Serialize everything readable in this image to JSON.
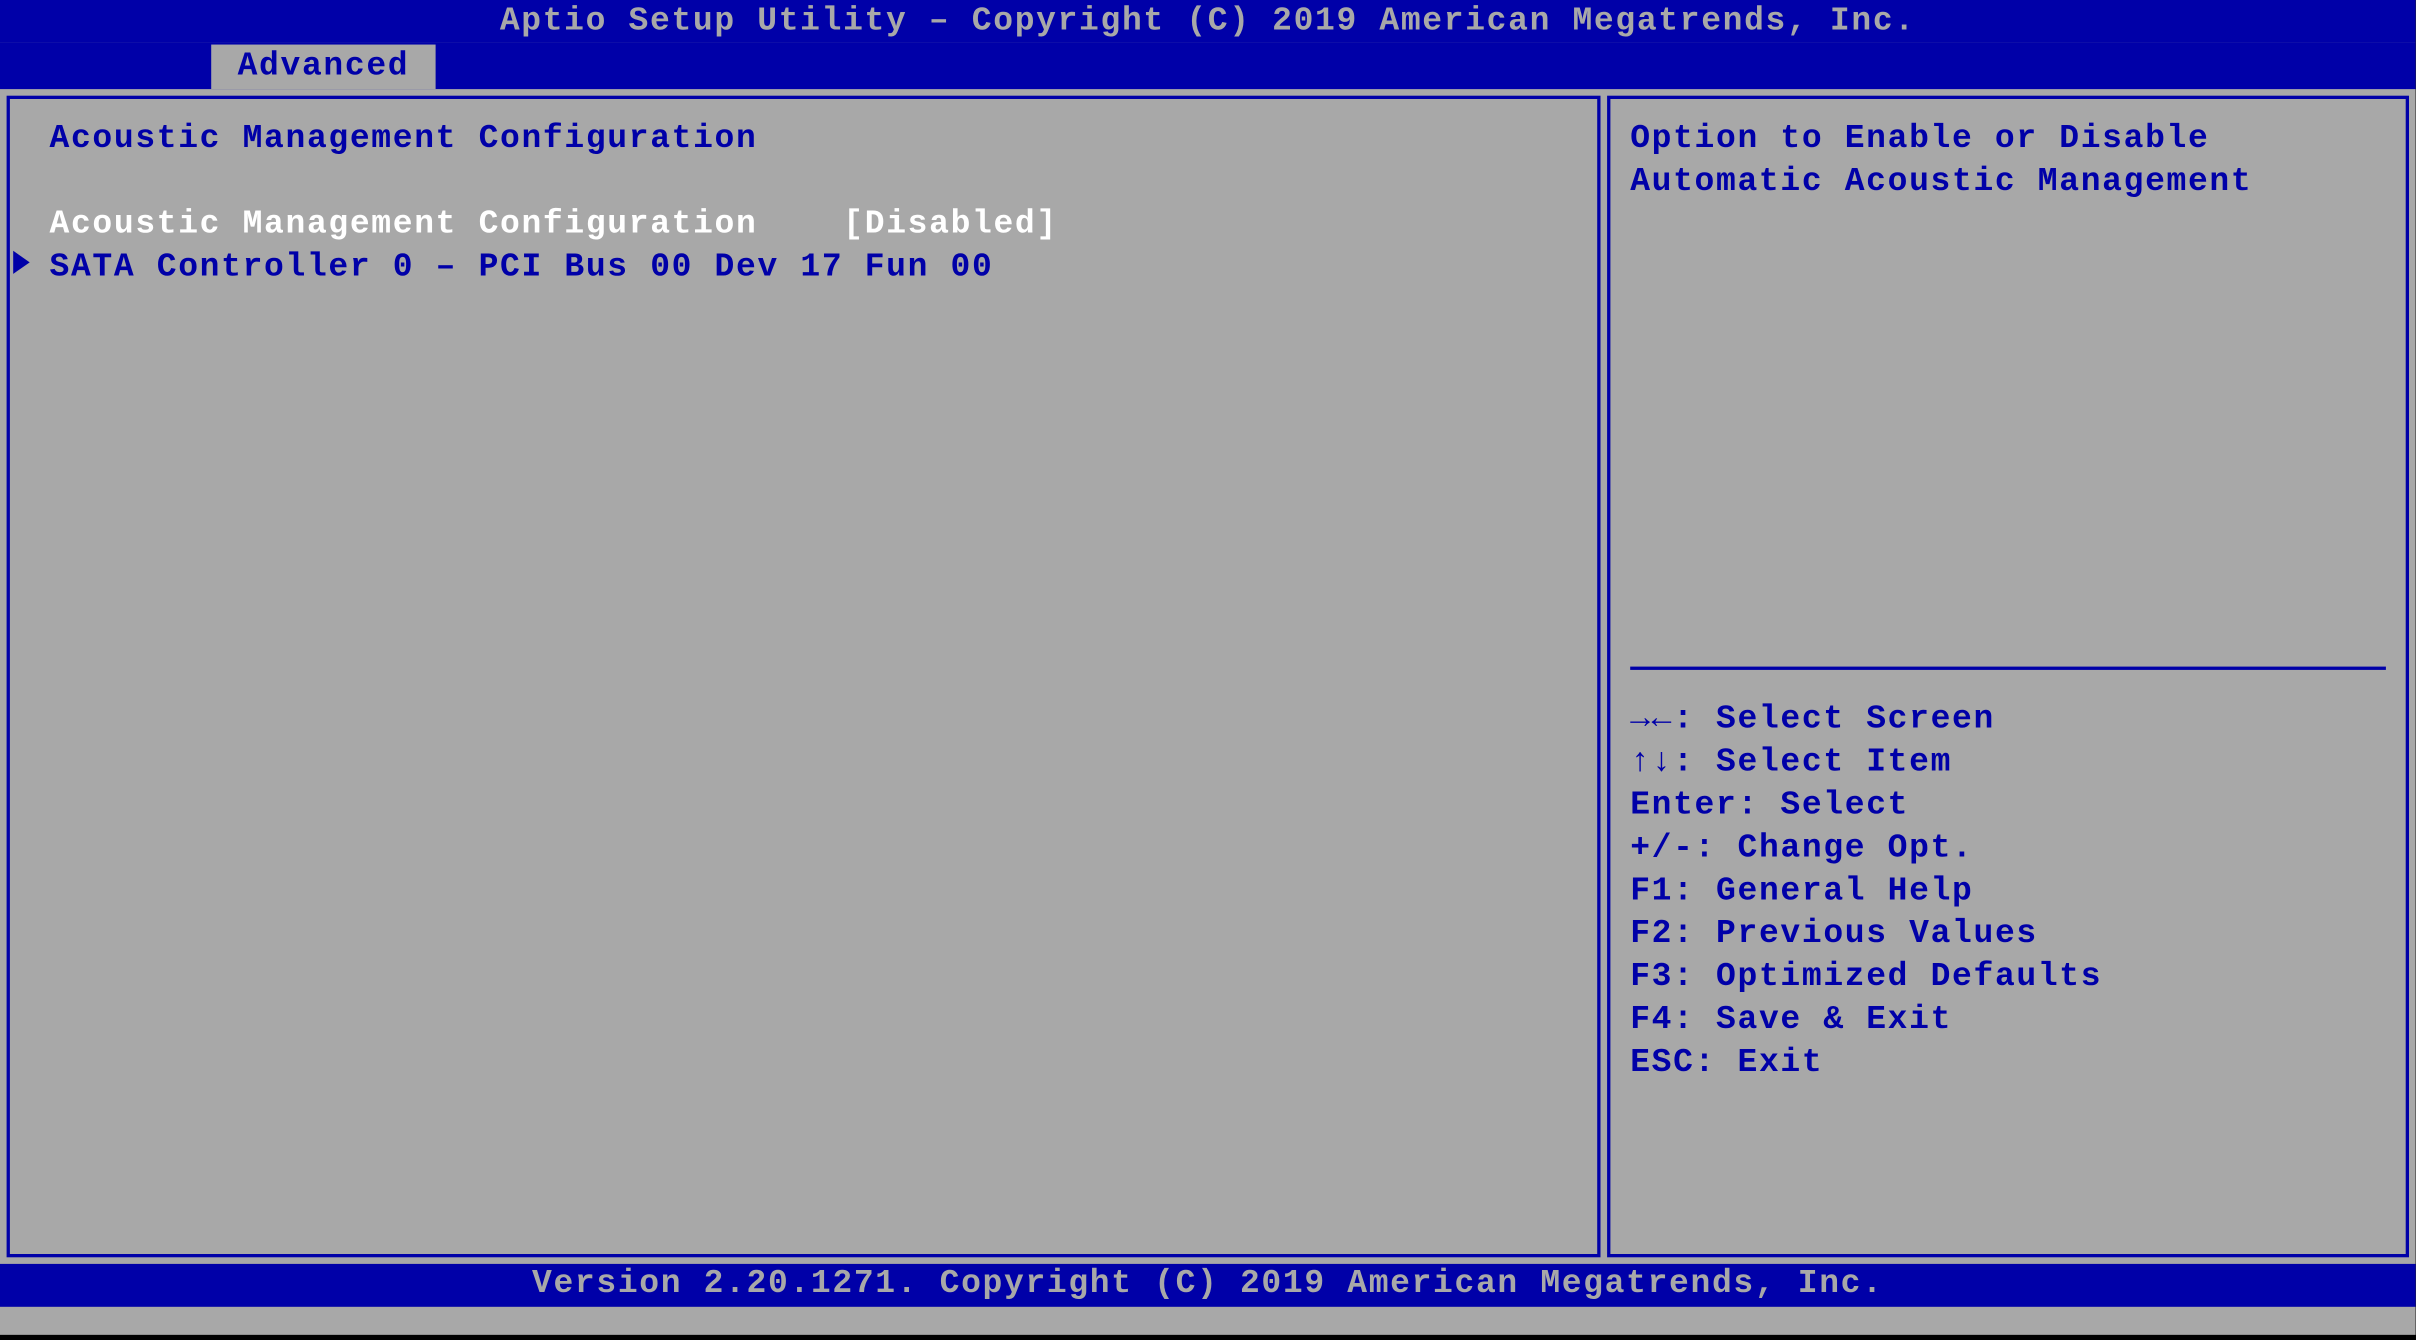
{
  "header": {
    "title": "Aptio Setup Utility – Copyright (C) 2019 American Megatrends, Inc."
  },
  "tabs": {
    "active": "Advanced"
  },
  "main": {
    "section_title": "Acoustic Management Configuration",
    "setting": {
      "label": "Acoustic Management Configuration",
      "value": "[Disabled]"
    },
    "submenu": {
      "label": "SATA Controller 0 – PCI Bus 00 Dev 17 Fun 00"
    }
  },
  "help": {
    "text": "Option to Enable or Disable Automatic Acoustic Management"
  },
  "keybinds": [
    {
      "key": "→←:",
      "action": "Select Screen"
    },
    {
      "key": "↑↓:",
      "action": "Select Item"
    },
    {
      "key": "Enter:",
      "action": "Select"
    },
    {
      "key": "+/-:",
      "action": "Change Opt."
    },
    {
      "key": "F1:",
      "action": "General Help"
    },
    {
      "key": "F2:",
      "action": "Previous Values"
    },
    {
      "key": "F3:",
      "action": "Optimized Defaults"
    },
    {
      "key": "F4:",
      "action": "Save & Exit"
    },
    {
      "key": "ESC:",
      "action": "Exit"
    }
  ],
  "footer": {
    "text": "Version 2.20.1271. Copyright (C) 2019 American Megatrends, Inc."
  }
}
